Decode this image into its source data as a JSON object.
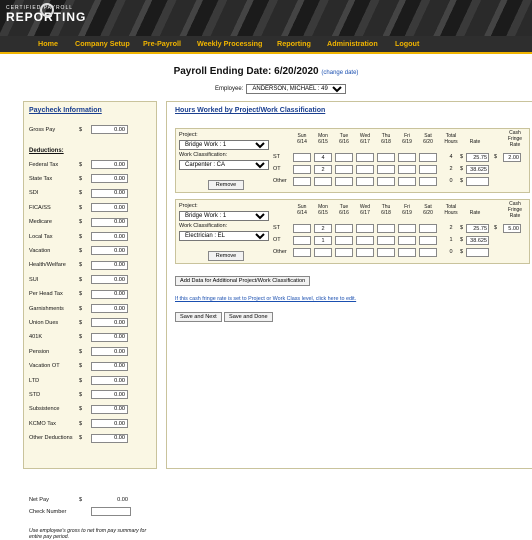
{
  "logo": {
    "line1": "CERTIFIED PAYROLL",
    "line2": "REPORTING"
  },
  "nav": [
    "Home",
    "Company Setup",
    "Pre-Payroll",
    "Weekly Processing",
    "Reporting",
    "Administration",
    "Logout"
  ],
  "page": {
    "title": "Payroll Ending Date: 6/20/2020",
    "change_link": "(change date)"
  },
  "employee": {
    "label": "Employee:",
    "selected": "ANDERSON, MICHAEL : 49"
  },
  "paycheck": {
    "header": "Paycheck Information",
    "gross": {
      "label": "Gross Pay",
      "currency": "$",
      "value": "0.00"
    },
    "deductions_header": "Deductions:",
    "deductions": [
      {
        "label": "Federal Tax",
        "value": "0.00"
      },
      {
        "label": "State Tax",
        "value": "0.00"
      },
      {
        "label": "SDI",
        "value": "0.00"
      },
      {
        "label": "FICA/SS",
        "value": "0.00"
      },
      {
        "label": "Medicare",
        "value": "0.00"
      },
      {
        "label": "Local Tax",
        "value": "0.00"
      },
      {
        "label": "Vacation",
        "value": "0.00"
      },
      {
        "label": "Health/Welfare",
        "value": "0.00"
      },
      {
        "label": "SUI",
        "value": "0.00"
      },
      {
        "label": "Per Head Tax",
        "value": "0.00"
      },
      {
        "label": "Garnishments",
        "value": "0.00"
      },
      {
        "label": "Union Dues",
        "value": "0.00"
      },
      {
        "label": "401K",
        "value": "0.00"
      },
      {
        "label": "Pension",
        "value": "0.00"
      },
      {
        "label": "Vacation OT",
        "value": "0.00"
      },
      {
        "label": "LTD",
        "value": "0.00"
      },
      {
        "label": "STD",
        "value": "0.00"
      },
      {
        "label": "Subsistence",
        "value": "0.00"
      },
      {
        "label": "KCMO Tax",
        "value": "0.00"
      },
      {
        "label": "Other Deductions",
        "value": "0.00"
      }
    ],
    "currency": "$",
    "net_pay": {
      "label": "Net Pay",
      "currency": "$",
      "value": "0.00"
    },
    "check_number": {
      "label": "Check Number",
      "value": ""
    },
    "note": "Use employee's gross to net from pay summary for entire pay period."
  },
  "hours": {
    "header": "Hours Worked by Project/Work Classification",
    "days": [
      {
        "day": "Sun",
        "date": "6/14"
      },
      {
        "day": "Mon",
        "date": "6/15"
      },
      {
        "day": "Tue",
        "date": "6/16"
      },
      {
        "day": "Wed",
        "date": "6/17"
      },
      {
        "day": "Thu",
        "date": "6/18"
      },
      {
        "day": "Fri",
        "date": "6/19"
      },
      {
        "day": "Sat",
        "date": "6/20"
      }
    ],
    "col_total": [
      "Total",
      "Hours"
    ],
    "col_rate": "Rate",
    "col_fringe": [
      "Cash",
      "Fringe",
      "Rate"
    ],
    "project_label": "Project:",
    "class_label": "Work Classification:",
    "remove_label": "Remove",
    "row_labels": [
      "ST",
      "OT",
      "Other"
    ],
    "blocks": [
      {
        "project": "Bridge Work : 1",
        "classification": "Carpenter : CA",
        "rows": [
          {
            "hours": [
              "",
              "4",
              "",
              "",
              "",
              "",
              ""
            ],
            "total": "4",
            "rate": "25.75",
            "fringe": "2.00"
          },
          {
            "hours": [
              "",
              "2",
              "",
              "",
              "",
              "",
              ""
            ],
            "total": "2",
            "rate": "38.625",
            "fringe": ""
          },
          {
            "hours": [
              "",
              "",
              "",
              "",
              "",
              "",
              ""
            ],
            "total": "0",
            "rate": "",
            "fringe": ""
          }
        ]
      },
      {
        "project": "Bridge Work : 1",
        "classification": "Electrician : EL",
        "rows": [
          {
            "hours": [
              "",
              "2",
              "",
              "",
              "",
              "",
              ""
            ],
            "total": "2",
            "rate": "25.75",
            "fringe": "5.00"
          },
          {
            "hours": [
              "",
              "1",
              "",
              "",
              "",
              "",
              ""
            ],
            "total": "1",
            "rate": "38.625",
            "fringe": ""
          },
          {
            "hours": [
              "",
              "",
              "",
              "",
              "",
              "",
              ""
            ],
            "total": "0",
            "rate": "",
            "fringe": ""
          }
        ]
      }
    ],
    "add_button": "Add Data for Additional Project/Work Classification",
    "fringe_link": "If this cash fringe rate is set to Project or Work Class level, click here to edit.",
    "save_next": "Save and Next",
    "save_done": "Save and Done"
  }
}
